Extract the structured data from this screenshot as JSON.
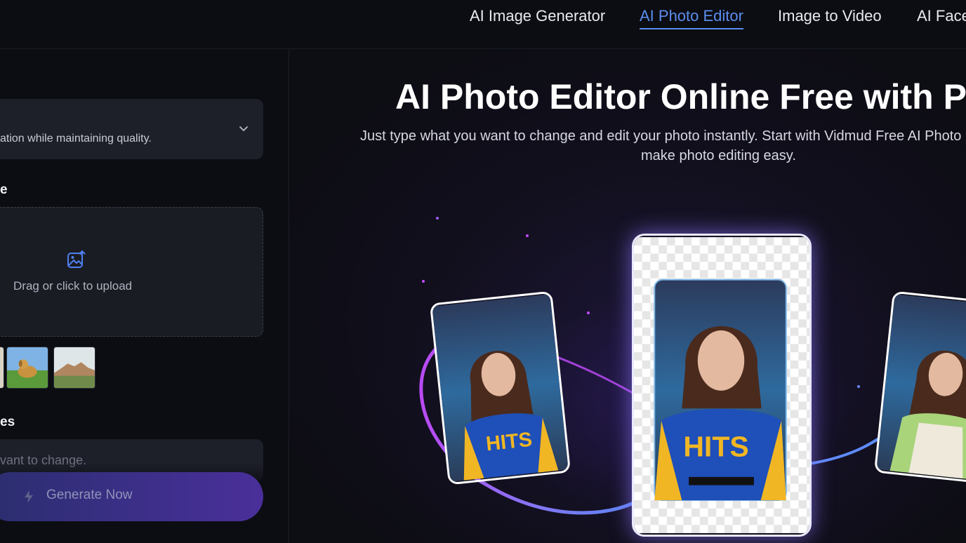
{
  "nav": {
    "items": [
      {
        "label": "AI Image Generator",
        "active": false
      },
      {
        "label": "AI Photo Editor",
        "active": true
      },
      {
        "label": "Image to Video",
        "active": false
      },
      {
        "label": "AI Face",
        "active": false
      }
    ]
  },
  "sidebar": {
    "model_select": {
      "description": "ation while maintaining quality.",
      "icon": "chevron-down-icon"
    },
    "upload_section_label": "e",
    "upload": {
      "text": "Drag or click to upload",
      "icon": "image-upload-icon"
    },
    "sample_thumbnails": [
      "dog-on-grass",
      "rock-landscape"
    ],
    "prompt_section_label": "es",
    "prompt": {
      "placeholder": "vant to change."
    },
    "generate_button": {
      "label": "Generate Now",
      "icon": "lightning-icon"
    }
  },
  "hero": {
    "title": "AI Photo Editor Online Free with Pro",
    "subtitle_line1": "Just type what you want to change and edit your photo instantly. Start with Vidmud Free AI Photo",
    "subtitle_line2": "make photo editing easy."
  },
  "colors": {
    "accent": "#5b8def",
    "background": "#0c0d12",
    "panel": "#1d1f29",
    "button_gradient_start": "#2b2e6e",
    "button_gradient_end": "#4a2f9a"
  }
}
